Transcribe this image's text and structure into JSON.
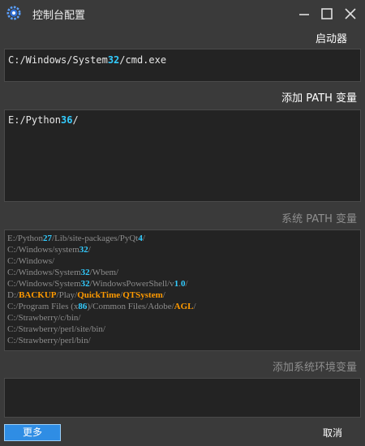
{
  "window": {
    "title": "控制台配置"
  },
  "toolbar": {
    "launch_label": "启动器"
  },
  "command": {
    "prefix": "C:/Windows/System",
    "num": "32",
    "suffix": "/cmd.exe"
  },
  "user_path": {
    "add_label": "添加 PATH 变量",
    "value_prefix": "E:/Python",
    "value_num": "36",
    "value_suffix": "/"
  },
  "system_path": {
    "label": "系统 PATH 变量",
    "entries": [
      [
        {
          "t": "E:/Python"
        },
        {
          "t": "27",
          "k": "n"
        },
        {
          "t": "/Lib/site-packages/PyQt"
        },
        {
          "t": "4",
          "k": "n"
        },
        {
          "t": "/"
        }
      ],
      [
        {
          "t": "C:/Windows/system"
        },
        {
          "t": "32",
          "k": "n"
        },
        {
          "t": "/"
        }
      ],
      [
        {
          "t": "C:/Windows/"
        }
      ],
      [
        {
          "t": "C:/Windows/System"
        },
        {
          "t": "32",
          "k": "n"
        },
        {
          "t": "/Wbem/"
        }
      ],
      [
        {
          "t": "C:/Windows/System"
        },
        {
          "t": "32",
          "k": "n"
        },
        {
          "t": "/WindowsPowerShell/v"
        },
        {
          "t": "1",
          "k": "n"
        },
        {
          "t": "."
        },
        {
          "t": "0",
          "k": "n"
        },
        {
          "t": "/"
        }
      ],
      [
        {
          "t": "D:/"
        },
        {
          "t": "BACKUP",
          "k": "h"
        },
        {
          "t": "/Play/"
        },
        {
          "t": "QuickTime",
          "k": "h"
        },
        {
          "t": "/"
        },
        {
          "t": "QTSystem",
          "k": "h"
        },
        {
          "t": "/"
        }
      ],
      [
        {
          "t": "C:/Program Files (x"
        },
        {
          "t": "86",
          "k": "n"
        },
        {
          "t": ")/Common Files/Adobe/"
        },
        {
          "t": "AGL",
          "k": "h"
        },
        {
          "t": "/"
        }
      ],
      [
        {
          "t": "C:/Strawberry/c/bin/"
        }
      ],
      [
        {
          "t": "C:/Strawberry/perl/site/bin/"
        }
      ],
      [
        {
          "t": "C:/Strawberry/perl/bin/"
        }
      ]
    ]
  },
  "env": {
    "add_label": "添加系统环境变量"
  },
  "footer": {
    "more_label": "更多",
    "cancel_label": "取消"
  },
  "colors": {
    "number": "#33ccff",
    "highlight": "#ff9a00",
    "accent": "#2f8de4"
  }
}
